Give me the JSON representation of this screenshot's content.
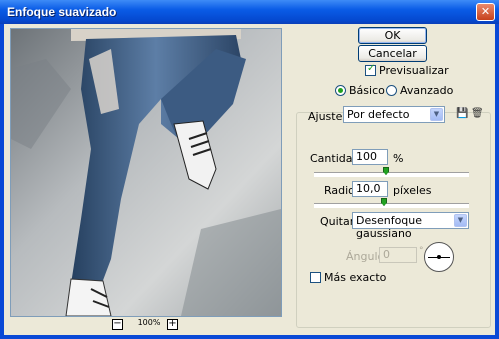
{
  "window": {
    "title": "Enfoque suavizado"
  },
  "preview": {
    "zoom": "100%",
    "zoom_out_icon": "minus-icon",
    "zoom_in_icon": "plus-icon"
  },
  "buttons": {
    "ok": "OK",
    "cancel": "Cancelar"
  },
  "preview_checkbox": {
    "label": "Previsualizar",
    "checked": true
  },
  "mode": {
    "basic": "Básico",
    "advanced": "Avanzado",
    "selected": "Básico"
  },
  "settings": {
    "label": "Ajustes:",
    "value": "Por defecto",
    "save_icon": "save-icon",
    "delete_icon": "trash-icon"
  },
  "amount": {
    "label": "Cantidad:",
    "value": "100",
    "unit": "%",
    "slider_fraction": 0.33
  },
  "radius": {
    "label": "Radio:",
    "value": "10,0",
    "unit": "píxeles",
    "slider_fraction": 0.35
  },
  "remove": {
    "label": "Quitar:",
    "value": "Desenfoque gaussiano"
  },
  "angle": {
    "label": "Ángulo:",
    "value": "0",
    "unit": "°"
  },
  "more_accurate": {
    "label": "Más exacto",
    "checked": false
  },
  "colors": {
    "titlebar": "#0a5ce6",
    "dialog": "#ece9d8",
    "accent_green": "#21a121"
  }
}
